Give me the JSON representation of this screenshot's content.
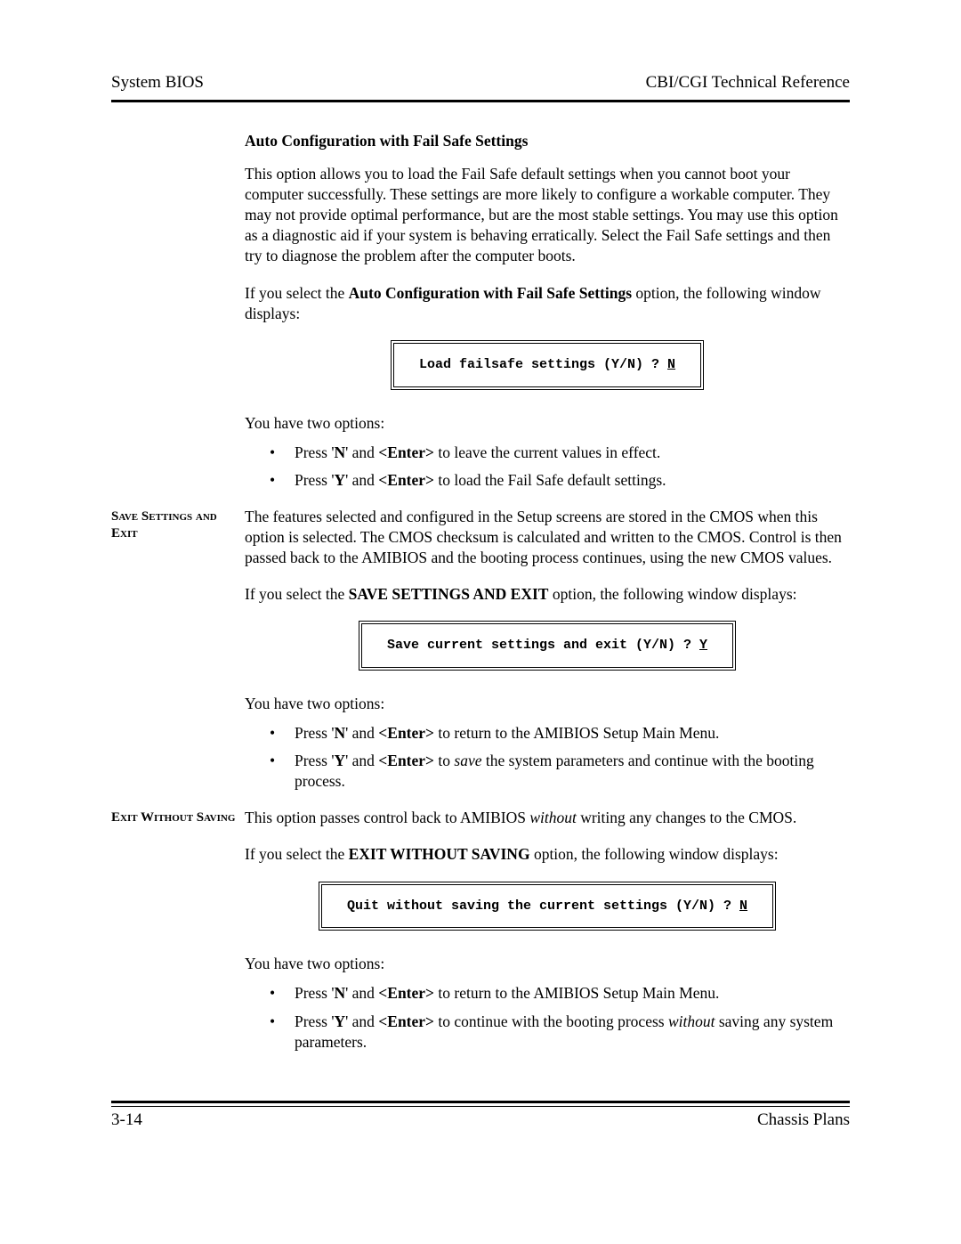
{
  "header": {
    "left": "System BIOS",
    "right": "CBI/CGI Technical Reference"
  },
  "s1": {
    "heading": "Auto Configuration with Fail Safe Settings",
    "para1": "This option allows you to load the Fail Safe default settings when you cannot boot your computer successfully.  These settings are more likely to configure a workable computer.  They may not provide optimal performance, but are the most stable settings.  You may use this option as a diagnostic aid if your system is behaving erratically.  Select the Fail Safe settings and then try to diagnose the problem after the computer boots.",
    "para2_pre": "If you select the ",
    "para2_bold": "Auto Configuration with Fail Safe Settings",
    "para2_post": " option, the following window displays:",
    "dialog_text": "Load failsafe settings (Y/N) ? ",
    "dialog_answer": "N",
    "options_lead": "You have two options:",
    "opt1_a": "Press '",
    "opt1_key": "N",
    "opt1_b": "' and ",
    "opt1_enter": "<Enter>",
    "opt1_c": " to leave the current values in effect.",
    "opt2_a": "Press '",
    "opt2_key": "Y",
    "opt2_b": "' and ",
    "opt2_enter": "<Enter>",
    "opt2_c": " to load the Fail Safe default settings."
  },
  "s2": {
    "side": "Save Settings and Exit",
    "para1": "The features selected and configured in the Setup screens are stored in the CMOS when this option is selected.  The CMOS checksum is calculated and written to the CMOS.  Control is then passed back to the AMIBIOS and the booting process continues, using the new CMOS values.",
    "para2_pre": "If you select the ",
    "para2_bold": "SAVE SETTINGS AND EXIT",
    "para2_post": " option, the following window displays:",
    "dialog_text": "Save current settings and exit (Y/N) ? ",
    "dialog_answer": "Y",
    "options_lead": "You have two options:",
    "opt1_a": "Press '",
    "opt1_key": "N",
    "opt1_b": "'  and ",
    "opt1_enter": "<Enter>",
    "opt1_c": " to return to the AMIBIOS Setup Main Menu.",
    "opt2_a": "Press '",
    "opt2_key": "Y",
    "opt2_b": "' and ",
    "opt2_enter": "<Enter>",
    "opt2_c": " to ",
    "opt2_italic": "save",
    "opt2_d": " the system parameters and continue with the booting process."
  },
  "s3": {
    "side": "Exit Without Saving",
    "para1_a": "This option passes control back to AMIBIOS ",
    "para1_italic": "without",
    "para1_b": " writing any changes to the CMOS.",
    "para2_pre": "If you select the ",
    "para2_bold": "EXIT WITHOUT SAVING",
    "para2_post": " option, the following window displays:",
    "dialog_text": "Quit without saving the current settings (Y/N) ? ",
    "dialog_answer": "N",
    "options_lead": "You have two options:",
    "opt1_a": "Press '",
    "opt1_key": "N",
    "opt1_b": "' and ",
    "opt1_enter": "<Enter>",
    "opt1_c": " to return to the AMIBIOS Setup Main Menu.",
    "opt2_a": "Press '",
    "opt2_key": "Y",
    "opt2_b": "' and ",
    "opt2_enter": "<Enter>",
    "opt2_c": " to continue with the booting process ",
    "opt2_italic": "without",
    "opt2_d": " saving any system parameters."
  },
  "footer": {
    "left": "3-14",
    "right": "Chassis Plans"
  }
}
